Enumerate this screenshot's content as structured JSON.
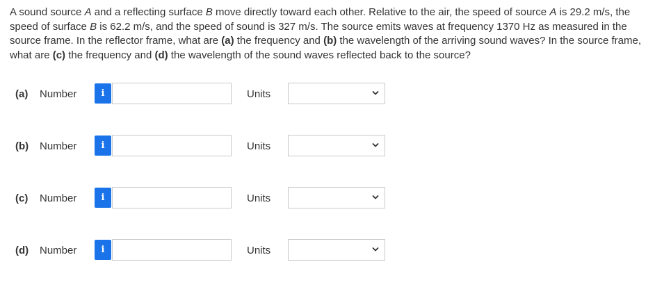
{
  "question": {
    "segments": [
      {
        "t": "A sound source ",
        "s": "n"
      },
      {
        "t": "A",
        "s": "i"
      },
      {
        "t": " and a reflecting surface ",
        "s": "n"
      },
      {
        "t": "B",
        "s": "i"
      },
      {
        "t": " move directly toward each other. Relative to the air, the speed of source ",
        "s": "n"
      },
      {
        "t": "A",
        "s": "i"
      },
      {
        "t": " is 29.2 m/s, the speed of surface ",
        "s": "n"
      },
      {
        "t": "B",
        "s": "i"
      },
      {
        "t": " is 62.2 m/s, and the speed of sound is 327 m/s. The source emits waves at frequency 1370 Hz as measured in the source frame. In the reflector frame, what are ",
        "s": "n"
      },
      {
        "t": "(a)",
        "s": "b"
      },
      {
        "t": " the frequency and ",
        "s": "n"
      },
      {
        "t": "(b)",
        "s": "b"
      },
      {
        "t": " the wavelength of the arriving sound waves? In the source frame, what are ",
        "s": "n"
      },
      {
        "t": "(c)",
        "s": "b"
      },
      {
        "t": " the frequency and ",
        "s": "n"
      },
      {
        "t": "(d)",
        "s": "b"
      },
      {
        "t": " the wavelength of the sound waves reflected back to the source?",
        "s": "n"
      }
    ]
  },
  "info_icon": "i",
  "answers": [
    {
      "part": "(a)",
      "number_label": "Number",
      "number_value": "",
      "units_label": "Units",
      "units_value": ""
    },
    {
      "part": "(b)",
      "number_label": "Number",
      "number_value": "",
      "units_label": "Units",
      "units_value": ""
    },
    {
      "part": "(c)",
      "number_label": "Number",
      "number_value": "",
      "units_label": "Units",
      "units_value": ""
    },
    {
      "part": "(d)",
      "number_label": "Number",
      "number_value": "",
      "units_label": "Units",
      "units_value": ""
    }
  ],
  "colors": {
    "info_button": "#1a73e8",
    "text": "#333333",
    "border": "#c9c9c9"
  },
  "icons": {
    "info": "info-icon",
    "dropdown": "chevron-down-icon"
  }
}
